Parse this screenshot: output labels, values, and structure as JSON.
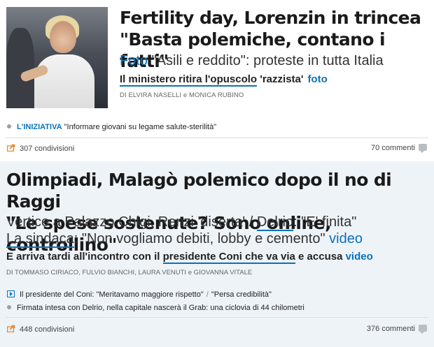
{
  "article1": {
    "title_line1": "Fertility day, Lorenzin in trincea",
    "title_line2": "\"Basta polemiche, contano i fatti\"",
    "sub_link": "Foto",
    "sub_text": " \"Asili e reddito\": proteste in tutta Italia",
    "line3_underlined": "Il ministero ritira l'opuscolo",
    "line3_text": " 'razzista'",
    "line3_link": "foto",
    "byline_author1": "di ELVIRA NASELLI",
    "byline_e": " e ",
    "byline_author2": "MONICA RUBINO",
    "related_kicker": "L'INIZIATIVA",
    "related_text": " \"Informare giovani su legame salute-sterilità\"",
    "shares": "307 condivisioni",
    "comments": "70 commenti",
    "photo_alt": "photo-beatrice-lorenzin"
  },
  "article2": {
    "title_line1": "Olimpiadi, Malagò polemico dopo il no di Raggi",
    "title_line2": "\"Le spese sostenute? Sono online, controllino\"",
    "sub_a": "Vertice a Palazzo Chigi, Renzi 'diserta' / ",
    "sub_b_underlined": "Delrio",
    "sub_c": ": \"E' finita\"",
    "sub_d_underlined": "La sindaca",
    "sub_e": ": \"Non vogliamo debiti, lobby e cemento\"",
    "sub_link": "video",
    "line4_a": "E arriva tardi all'incontro con il ",
    "line4_underlined": "presidente Coni che va via",
    "line4_b": " e accusa ",
    "line4_link": "video",
    "byline_authors": "di TOMMASO CIRIACO, FULVIO BIANCHI, LAURA VENUTI",
    "byline_e": " e ",
    "byline_last": "GIOVANNA VITALE",
    "related1_a": "Il presidente del Coni: \"Meritavamo maggiore rispetto\"",
    "related1_slash": "/",
    "related1_b": "\"Persa credibilità\"",
    "related2": "Firmata intesa con Delrio, nella capitale nascerà il Grab: una ciclovia di 44 chilometri",
    "shares": "448 condivisioni",
    "comments": "376 commenti"
  },
  "colors": {
    "link_blue": "#0a72ba",
    "share_orange": "#e8862a",
    "article2_bg": "#eef3f8"
  },
  "icons": {
    "share": "share-icon",
    "comment": "comment-icon",
    "video": "video-icon",
    "bullet": "bullet-icon"
  }
}
